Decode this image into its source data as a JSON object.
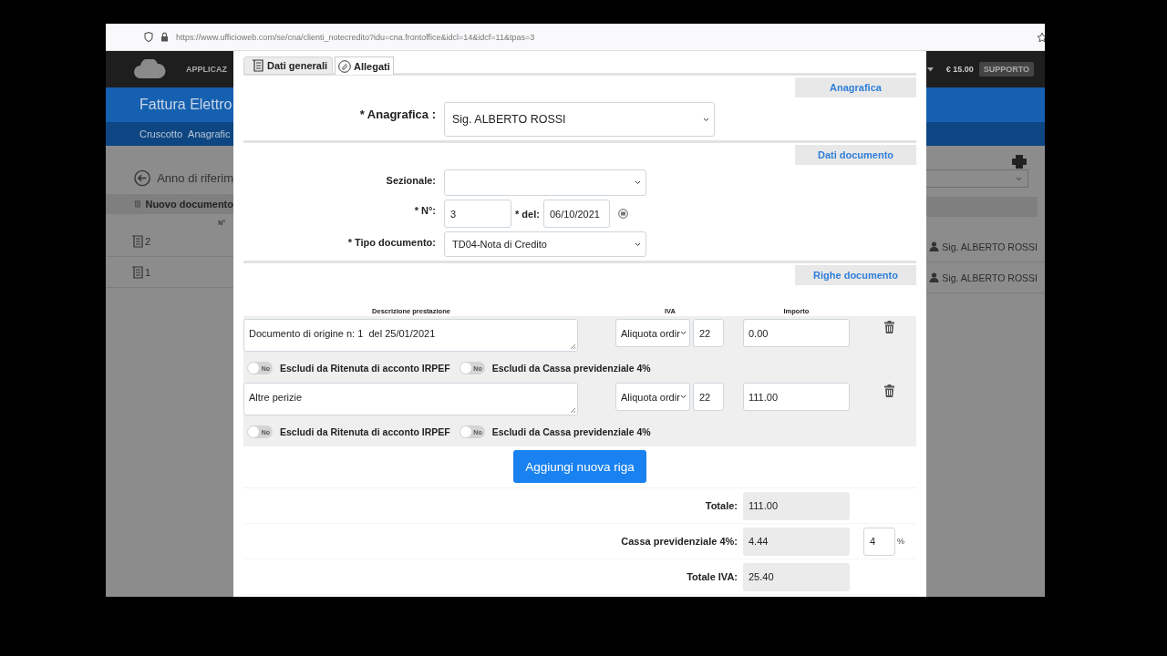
{
  "browser": {
    "url": "https://www.ufficioweb.com/se/cna/clienti_notecredito?idu=cna.frontoffice&idcl=14&idcf=11&tpas=3"
  },
  "app": {
    "header": {
      "menu": "APPLICAZ",
      "credit": "€ 15.00",
      "support": "SUPPORTO"
    },
    "title": "Fattura Elettro",
    "nav": [
      "Cruscotto",
      "Anagrafic"
    ],
    "left": {
      "back": "Anno di riferim",
      "new_document": "Nuovo documento",
      "column": "N°",
      "rows": [
        "2",
        "1"
      ]
    },
    "right": {
      "rows": [
        "Sig. ALBERTO ROSSI",
        "Sig. ALBERTO ROSSI"
      ]
    }
  },
  "modal": {
    "tabs": [
      {
        "label": "Dati generali",
        "selected": true
      },
      {
        "label": "Allegati",
        "selected": false
      }
    ],
    "anagrafica": {
      "heading": "Anagrafica",
      "label": "* Anagrafica :",
      "value": "Sig. ALBERTO ROSSI"
    },
    "dati_documento": {
      "heading": "Dati documento",
      "sezionale": {
        "label": "Sezionale:"
      },
      "numero": {
        "label": "* N°:",
        "value": "3"
      },
      "data": {
        "label": "* del:",
        "value": "06/10/2021"
      },
      "tipo": {
        "label": "* Tipo documento:",
        "value": "TD04-Nota di Credito"
      }
    },
    "righe": {
      "heading": "Righe documento",
      "columns": [
        "Descrizione prestazione",
        "IVA",
        "Importo"
      ],
      "lines": [
        {
          "description": "Documento di origine n: 1  del 25/01/2021",
          "iva_type": "Aliquota ordir",
          "iva_rate": "22",
          "amount": "0.00",
          "toggles": [
            {
              "label": "Escludi da Ritenuta di acconto IRPEF",
              "state": "No",
              "on": false
            },
            {
              "label": "Escludi da Cassa previdenziale 4%",
              "state": "No",
              "on": false
            }
          ]
        },
        {
          "description": "Altre perizie",
          "iva_type": "Aliquota ordir",
          "iva_rate": "22",
          "amount": "111.00",
          "toggles": [
            {
              "label": "Escludi da Ritenuta di acconto IRPEF",
              "state": "No",
              "on": false
            },
            {
              "label": "Escludi da Cassa previdenziale 4%",
              "state": "No",
              "on": false
            }
          ]
        }
      ],
      "add_button": "Aggiungi nuova riga"
    },
    "totals": [
      {
        "label": "Totale:",
        "value": "111.00"
      },
      {
        "label": "Cassa previdenziale 4%:",
        "value": "4.44",
        "rate": "4",
        "unit": "%"
      },
      {
        "label": "Totale IVA:",
        "value": "25.40"
      }
    ]
  }
}
